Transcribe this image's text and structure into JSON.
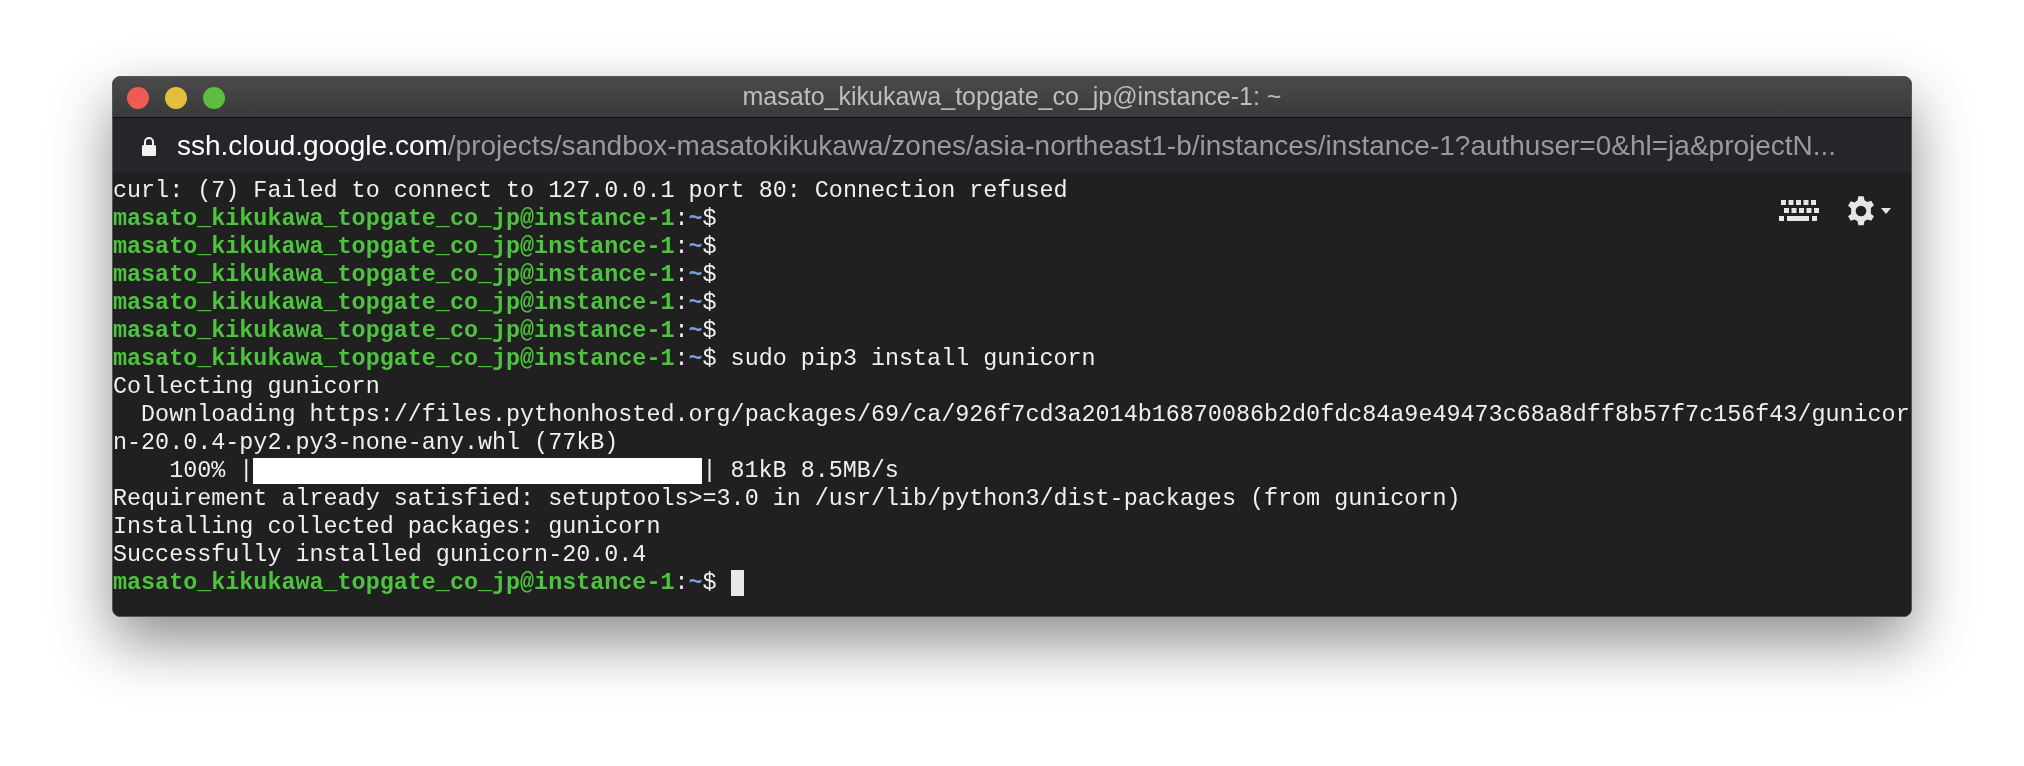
{
  "window": {
    "title": "masato_kikukawa_topgate_co_jp@instance-1: ~"
  },
  "address_bar": {
    "host": "ssh.cloud.google.com",
    "path": "/projects/sandbox-masatokikukawa/zones/asia-northeast1-b/instances/instance-1?authuser=0&hl=ja&projectN..."
  },
  "terminal": {
    "lines": [
      {
        "kind": "output",
        "text": "curl: (7) Failed to connect to 127.0.0.1 port 80: Connection refused"
      },
      {
        "kind": "prompt",
        "user": "masato_kikukawa_topgate_co_jp@instance-1",
        "separator": ":",
        "path": "~",
        "symbol": "$",
        "cursor": false
      },
      {
        "kind": "prompt",
        "user": "masato_kikukawa_topgate_co_jp@instance-1",
        "separator": ":",
        "path": "~",
        "symbol": "$",
        "cursor": false
      },
      {
        "kind": "prompt",
        "user": "masato_kikukawa_topgate_co_jp@instance-1",
        "separator": ":",
        "path": "~",
        "symbol": "$",
        "cursor": false
      },
      {
        "kind": "prompt",
        "user": "masato_kikukawa_topgate_co_jp@instance-1",
        "separator": ":",
        "path": "~",
        "symbol": "$",
        "cursor": false
      },
      {
        "kind": "prompt",
        "user": "masato_kikukawa_topgate_co_jp@instance-1",
        "separator": ":",
        "path": "~",
        "symbol": "$",
        "cursor": false
      },
      {
        "kind": "prompt",
        "user": "masato_kikukawa_topgate_co_jp@instance-1",
        "separator": ":",
        "path": "~",
        "symbol": "$",
        "command": "sudo pip3 install gunicorn",
        "cursor": false
      },
      {
        "kind": "output",
        "text": "Collecting gunicorn"
      },
      {
        "kind": "output",
        "text": "  Downloading https://files.pythonhosted.org/packages/69/ca/926f7cd3a2014b16870086b2d0fdc84a9e49473c68a8dff8b57f7c156f43/gunicor"
      },
      {
        "kind": "output",
        "text": "n-20.0.4-py2.py3-none-any.whl (77kB)"
      },
      {
        "kind": "progress",
        "prefix": "    100% |",
        "level": 1,
        "suffix": "| 81kB 8.5MB/s"
      },
      {
        "kind": "output",
        "text": "Requirement already satisfied: setuptools>=3.0 in /usr/lib/python3/dist-packages (from gunicorn)"
      },
      {
        "kind": "output",
        "text": "Installing collected packages: gunicorn"
      },
      {
        "kind": "output",
        "text": "Successfully installed gunicorn-20.0.4"
      },
      {
        "kind": "prompt",
        "user": "masato_kikukawa_topgate_co_jp@instance-1",
        "separator": ":",
        "path": "~",
        "symbol": "$",
        "cursor": true
      }
    ]
  }
}
